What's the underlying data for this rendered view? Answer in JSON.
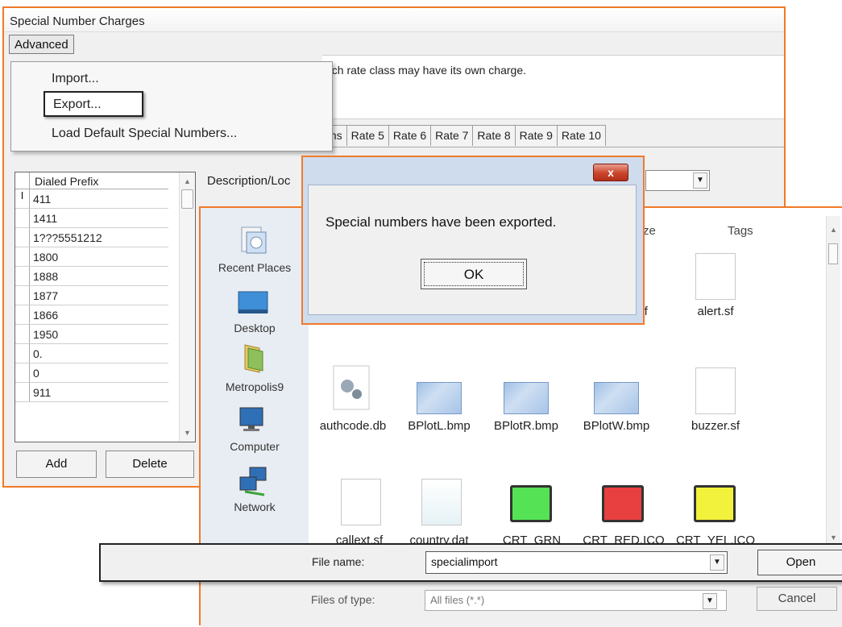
{
  "main_window": {
    "title": "Special Number Charges",
    "menu_label": "Advanced",
    "info_text": "ach rate class may have its own charge.",
    "tabs": [
      "ms",
      "Rate 5",
      "Rate 6",
      "Rate 7",
      "Rate 8",
      "Rate 9",
      "Rate 10"
    ],
    "grid_header": "Dialed Prefix",
    "prefixes": [
      "411",
      "1411",
      "1???5551212",
      "1800",
      "1888",
      "1877",
      "1866",
      "1950",
      "0.",
      "0",
      "911"
    ],
    "add_label": "Add",
    "delete_label": "Delete",
    "description_label": "Description/Loc"
  },
  "menu": {
    "import": "Import...",
    "export": "Export...",
    "load_default": "Load Default Special Numbers..."
  },
  "file_dialog": {
    "columns": {
      "partial": "ze",
      "tags": "Tags"
    },
    "places": [
      "Recent Places",
      "Desktop",
      "Metropolis9",
      "Computer",
      "Network"
    ],
    "files_row1": [
      ".sf",
      "alert.sf"
    ],
    "files_row2": [
      "authcode.db",
      "BPlotL.bmp",
      "BPlotR.bmp",
      "BPlotW.bmp",
      "buzzer.sf"
    ],
    "files_row3": [
      "callext.sf",
      "country.dat",
      "CRT_GRN",
      "CRT_RED.ICO",
      "CRT_YEL.ICO"
    ],
    "file_name_label": "File name:",
    "file_name_value": "specialimport",
    "open_label": "Open",
    "files_of_type_label": "Files of type:",
    "files_of_type_value": "All files (*.*)",
    "cancel_label": "Cancel"
  },
  "message": {
    "text": "Special numbers have been exported.",
    "ok_label": "OK",
    "close_glyph": "x"
  },
  "colors": {
    "highlight_border": "#f07a28",
    "monitor_green": "#55e255",
    "monitor_red": "#e84040",
    "monitor_yellow": "#f2f23c"
  }
}
